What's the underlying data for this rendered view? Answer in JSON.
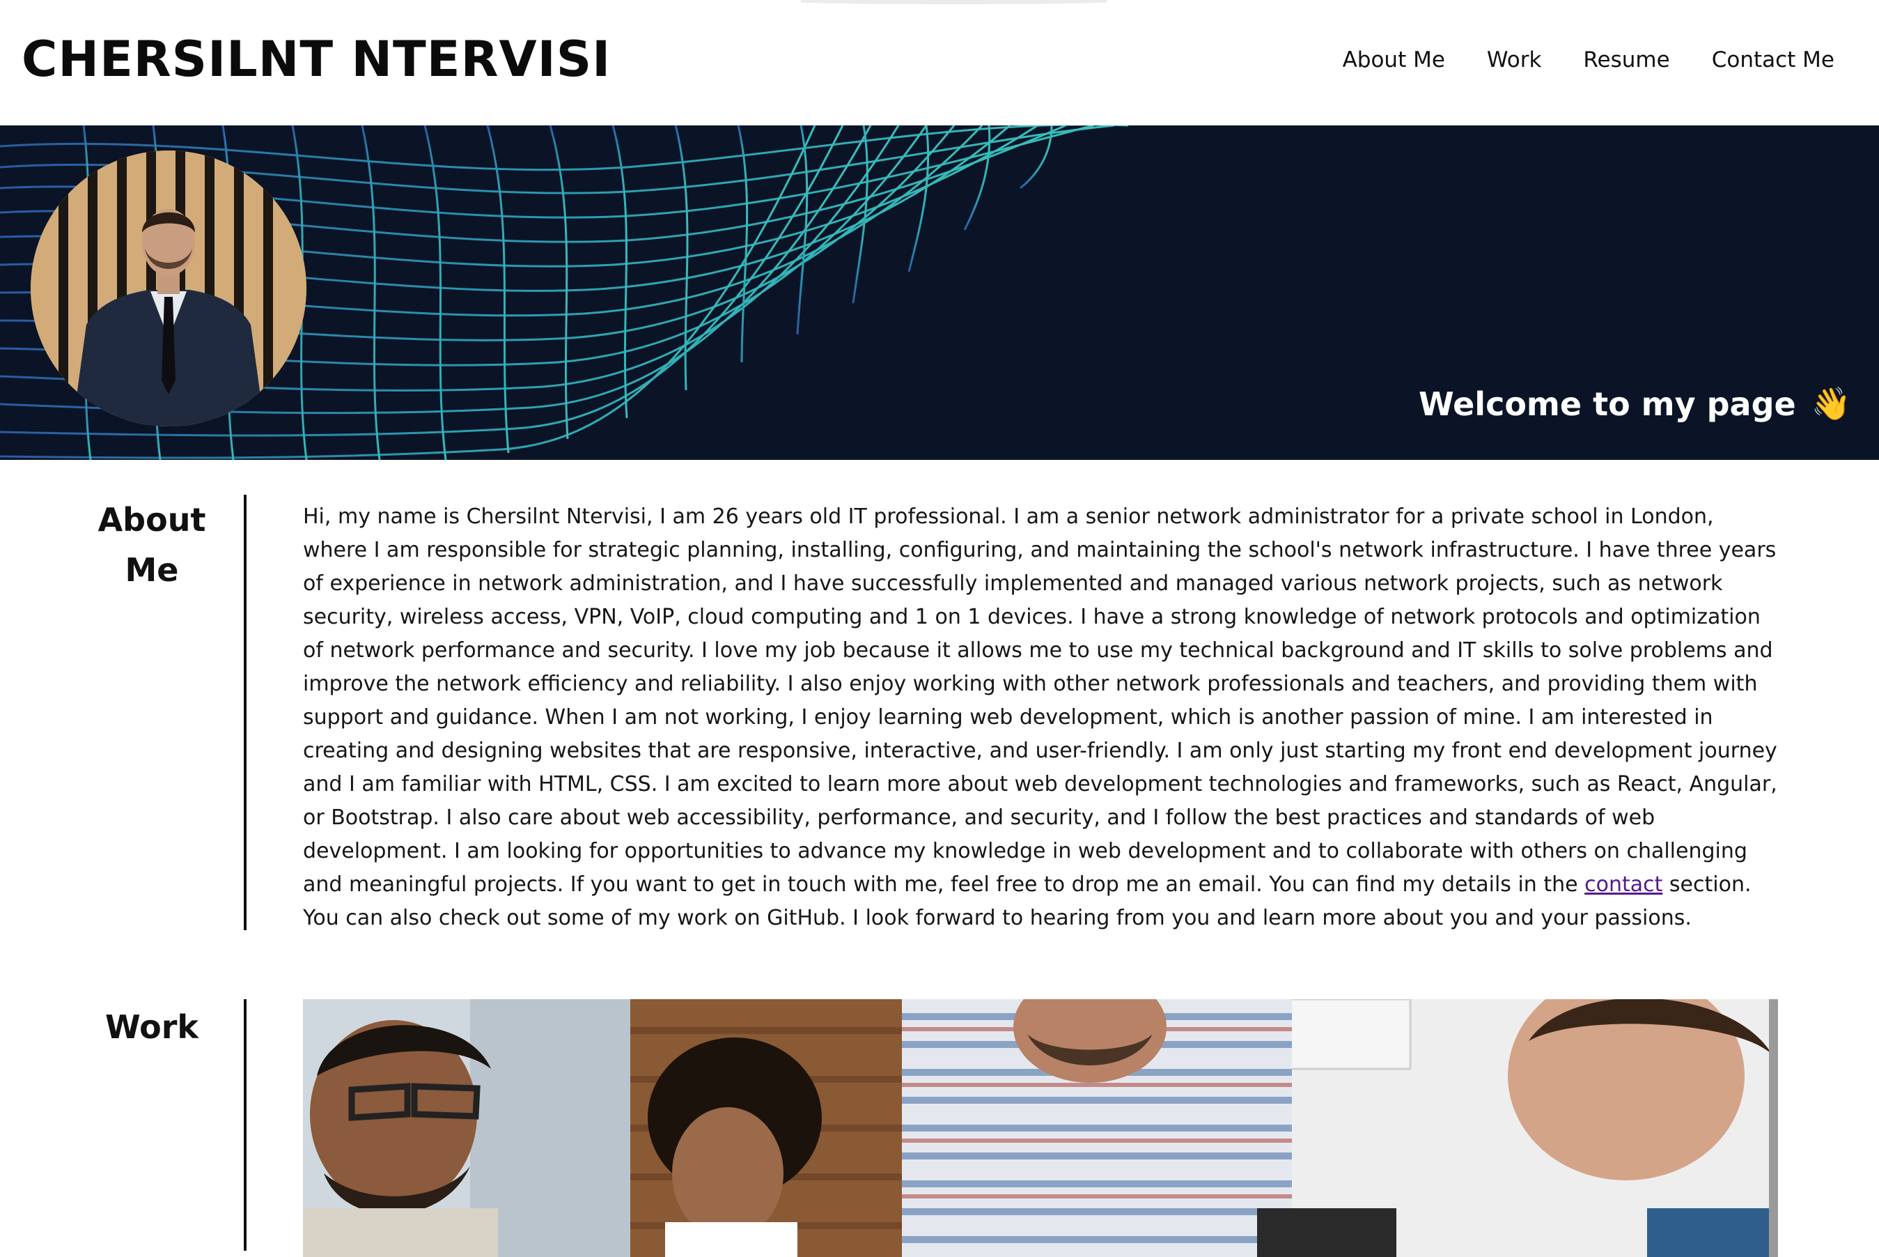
{
  "header": {
    "site_title": "CHERSILNT NTERVISI",
    "nav": [
      {
        "label": "About Me"
      },
      {
        "label": "Work"
      },
      {
        "label": "Resume"
      },
      {
        "label": "Contact Me"
      }
    ]
  },
  "hero": {
    "welcome_text": "Welcome to my page",
    "welcome_emoji": "👋",
    "background_color": "#0a1426",
    "wave_color": "#2fa6b8",
    "avatar_icon": "profile-photo"
  },
  "about": {
    "heading_line1": "About",
    "heading_line2": "Me",
    "text_before_link": "Hi, my name is Chersilnt Ntervisi, I am 26 years old IT professional. I am a senior network administrator for a private school in London, where I am responsible for strategic planning, installing, configuring, and maintaining the school's network infrastructure. I have three years of experience in network administration, and I have successfully implemented and managed various network projects, such as network security, wireless access, VPN, VoIP, cloud computing and 1 on 1 devices. I have a strong knowledge of network protocols and optimization of network performance and security. I love my job because it allows me to use my technical background and IT skills to solve problems and improve the network efficiency and reliability. I also enjoy working with other network professionals and teachers, and providing them with support and guidance. When I am not working, I enjoy learning web development, which is another passion of mine. I am interested in creating and designing websites that are responsive, interactive, and user-friendly. I am only just starting my front end development journey and I am familiar with HTML, CSS. I am excited to learn more about web development technologies and frameworks, such as React, Angular, or Bootstrap. I also care about web accessibility, performance, and security, and I follow the best practices and standards of web development. I am looking for opportunities to advance my knowledge in web development and to collaborate with others on challenging and meaningful projects. If you want to get in touch with me, feel free to drop me an email. You can find my details in the ",
    "link_text": "contact",
    "text_after_link": " section. You can also check out some of my work on GitHub. I look forward to hearing from you and learn more about you and your passions.",
    "link_color": "#551a8b"
  },
  "work": {
    "heading": "Work",
    "image_icon": "team-meeting-photo"
  }
}
